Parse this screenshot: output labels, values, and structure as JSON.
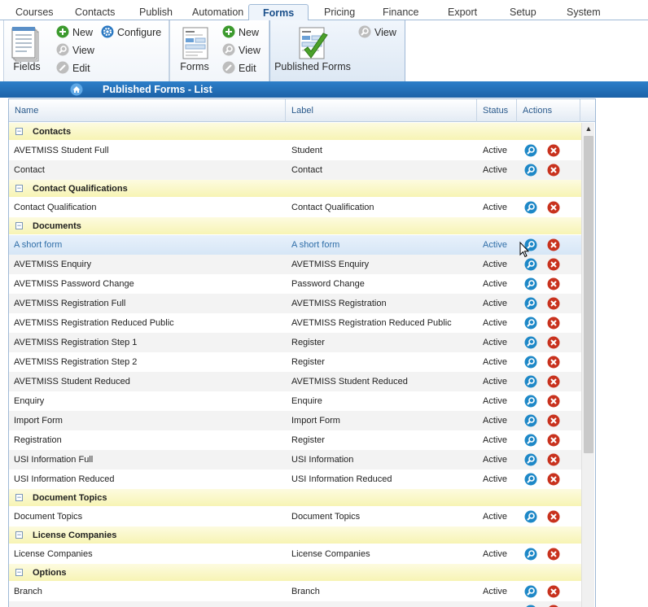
{
  "menu": {
    "tabs": [
      "Courses",
      "Contacts",
      "Publish",
      "Automation",
      "Forms",
      "Pricing",
      "Finance",
      "Export",
      "Setup",
      "System"
    ],
    "active": "Forms"
  },
  "ribbon": {
    "fields": {
      "label": "Fields",
      "new": "New",
      "configure": "Configure",
      "view": "View",
      "edit": "Edit"
    },
    "forms": {
      "label": "Forms",
      "new": "New",
      "view": "View",
      "edit": "Edit"
    },
    "published": {
      "label": "Published Forms",
      "view": "View"
    }
  },
  "titlebar": {
    "title": "Published Forms - List"
  },
  "grid": {
    "columns": {
      "name": "Name",
      "label": "Label",
      "status": "Status",
      "actions": "Actions"
    },
    "groups": [
      {
        "name": "Contacts",
        "rows": [
          {
            "name": "AVETMISS Student Full",
            "label": "Student",
            "status": "Active"
          },
          {
            "name": "Contact",
            "label": "Contact",
            "status": "Active"
          }
        ]
      },
      {
        "name": "Contact Qualifications",
        "rows": [
          {
            "name": "Contact Qualification",
            "label": "Contact Qualification",
            "status": "Active"
          }
        ]
      },
      {
        "name": "Documents",
        "rows": [
          {
            "name": "A short form",
            "label": "A short form",
            "status": "Active",
            "selected": true
          },
          {
            "name": "AVETMISS Enquiry",
            "label": "AVETMISS Enquiry",
            "status": "Active"
          },
          {
            "name": "AVETMISS Password Change",
            "label": "Password Change",
            "status": "Active"
          },
          {
            "name": "AVETMISS Registration Full",
            "label": "AVETMISS Registration",
            "status": "Active"
          },
          {
            "name": "AVETMISS Registration Reduced Public",
            "label": "AVETMISS Registration Reduced Public",
            "status": "Active"
          },
          {
            "name": "AVETMISS Registration Step 1",
            "label": "Register",
            "status": "Active"
          },
          {
            "name": "AVETMISS Registration Step 2",
            "label": "Register",
            "status": "Active"
          },
          {
            "name": "AVETMISS Student Reduced",
            "label": "AVETMISS Student Reduced",
            "status": "Active"
          },
          {
            "name": "Enquiry",
            "label": "Enquire",
            "status": "Active"
          },
          {
            "name": "Import Form",
            "label": "Import Form",
            "status": "Active"
          },
          {
            "name": "Registration",
            "label": "Register",
            "status": "Active"
          },
          {
            "name": "USI Information Full",
            "label": "USI Information",
            "status": "Active"
          },
          {
            "name": "USI Information Reduced",
            "label": "USI Information Reduced",
            "status": "Active"
          }
        ]
      },
      {
        "name": "Document Topics",
        "rows": [
          {
            "name": "Document Topics",
            "label": "Document Topics",
            "status": "Active"
          }
        ]
      },
      {
        "name": "License Companies",
        "rows": [
          {
            "name": "License Companies",
            "label": "License Companies",
            "status": "Active"
          }
        ]
      },
      {
        "name": "Options",
        "rows": [
          {
            "name": "Branch",
            "label": "Branch",
            "status": "Active"
          },
          {
            "name": "",
            "label": "",
            "status": ""
          }
        ]
      }
    ]
  },
  "colors": {
    "accent": "#1c62a8",
    "group_bg": "#f7f4b4",
    "view_icon": "#1e88c7",
    "delete_icon": "#c8321e"
  }
}
